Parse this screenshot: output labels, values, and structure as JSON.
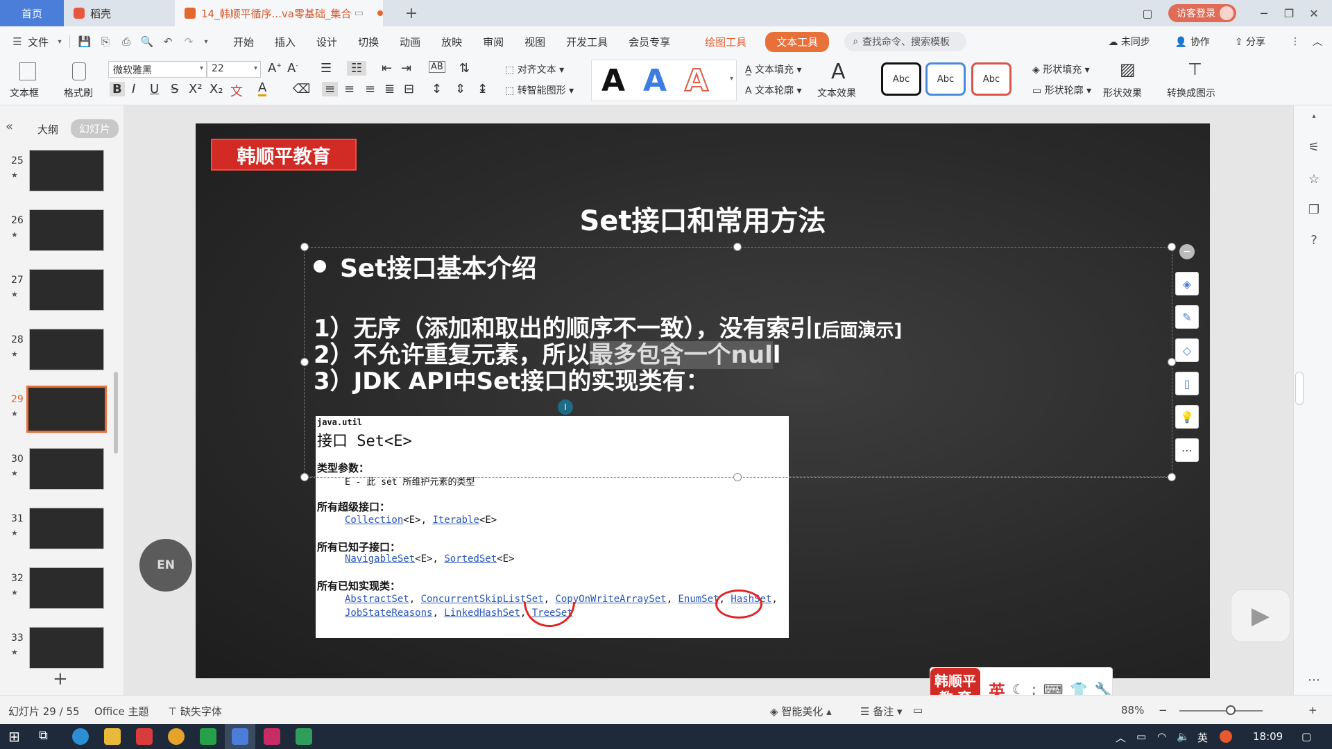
{
  "tabs": {
    "home": "首页",
    "daoke": "稻壳",
    "active": "14_韩顺平循序...va零基础_集合",
    "login": "访客登录"
  },
  "menu": {
    "file": "文件",
    "items": [
      "开始",
      "插入",
      "设计",
      "切换",
      "动画",
      "放映",
      "审阅",
      "视图",
      "开发工具",
      "会员专享"
    ],
    "draw_tool": "绘图工具",
    "text_tool": "文本工具",
    "search_placeholder": "查找命令、搜索模板",
    "unsynced": "未同步",
    "collab": "协作",
    "share": "分享"
  },
  "ribbon": {
    "textbox": "文本框",
    "format_painter": "格式刷",
    "font_name": "微软雅黑",
    "font_size": "22",
    "align_text": "对齐文本",
    "smart_shape": "转智能图形",
    "text_fill": "文本填充",
    "text_outline": "文本轮廓",
    "text_effect": "文本效果",
    "abc1": "Abc",
    "abc2": "Abc",
    "abc3": "Abc",
    "shape_fill": "形状填充",
    "shape_outline": "形状轮廓",
    "shape_effect": "形状效果",
    "to_diagram": "转换成图示"
  },
  "panel": {
    "outline_tab": "大纲",
    "slides_tab": "幻灯片",
    "slides": [
      {
        "num": "25"
      },
      {
        "num": "26"
      },
      {
        "num": "27"
      },
      {
        "num": "28"
      },
      {
        "num": "29"
      },
      {
        "num": "30"
      },
      {
        "num": "31"
      },
      {
        "num": "32"
      },
      {
        "num": "33"
      }
    ],
    "add": "+"
  },
  "slide": {
    "brand": "韩顺平教育",
    "title": "Set接口和常用方法",
    "heading": "Set接口基本介绍",
    "line1_main": "1）无序（添加和取出的顺序不一致），没有索引",
    "line1_note": "[后面演示]",
    "line2_a": "2）不允许重复元素，所以",
    "line2_hl": "最多包含一个nul",
    "line2_b": "l",
    "line3": "3）JDK API中Set接口的实现类有："
  },
  "javadoc": {
    "package": "java.util",
    "interface": "接口 Set<E>",
    "type_params_h": "类型参数：",
    "type_params_v": "E - 此 set 所维护元素的类型",
    "super_h": "所有超级接口：",
    "super_collection": "Collection",
    "super_collection_suffix": "<E>, ",
    "super_iterable": "Iterable",
    "super_iterable_suffix": "<E>",
    "sub_h": "所有已知子接口：",
    "sub_navigable": "NavigableSet",
    "sub_navigable_suffix": "<E>, ",
    "sub_sorted": "SortedSet",
    "sub_sorted_suffix": "<E>",
    "impl_h": "所有已知实现类：",
    "impl_row1": [
      "AbstractSet",
      "ConcurrentSkipListSet",
      "CopyOnWriteArraySet",
      "EnumSet",
      "HashSet"
    ],
    "impl_row2": [
      "JobStateReasons",
      "LinkedHashSet",
      "TreeSet"
    ]
  },
  "bubbles": {
    "en": "EN"
  },
  "ime": {
    "logo_line1": "韩顺平",
    "logo_line2": "教 育",
    "lang": "英"
  },
  "status": {
    "slide_pos": "幻灯片 29 / 55",
    "theme": "Office 主题",
    "missing_font": "缺失字体",
    "beautify": "智能美化",
    "notes": "备注",
    "zoom": "88%"
  },
  "taskbar": {
    "ime": "英",
    "time": "18:09"
  }
}
